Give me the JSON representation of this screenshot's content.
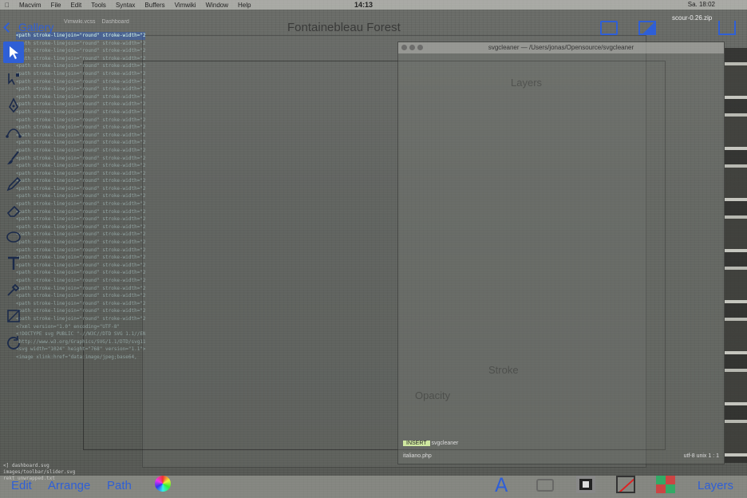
{
  "menubar": {
    "items": [
      "Macvim",
      "File",
      "Edit",
      "Tools",
      "Syntax",
      "Buffers",
      "Vimwiki",
      "Window",
      "Help"
    ],
    "clock": "14:13",
    "right_text": "Sa. 18:02"
  },
  "topbar": {
    "back_label": "Gallery",
    "document_title": "Fontainebleau Forest",
    "zip_label": "scour-0.26.zip"
  },
  "editor": {
    "tabs": [
      "Vimwiki.vcss",
      "Dashboard"
    ],
    "lines": [
      "<path stroke-linejoin=\"round\" stroke-width=\"2\" d=",
      "<path stroke-linejoin=\"round\" stroke-width=\"2\" d=",
      "<path stroke-linejoin=\"round\" stroke-width=\"2\" d=",
      "<path stroke-linejoin=\"round\" stroke-width=\"2\" d=",
      "<path stroke-linejoin=\"round\" stroke-width=\"2\" d=",
      "<path stroke-linejoin=\"round\" stroke-width=\"2\" d=",
      "<path stroke-linejoin=\"round\" stroke-width=\"2\" d=",
      "<path stroke-linejoin=\"round\" stroke-width=\"2\" d=",
      "<path stroke-linejoin=\"round\" stroke-width=\"2\" d=",
      "<path stroke-linejoin=\"round\" stroke-width=\"2\" d=",
      "<path stroke-linejoin=\"round\" stroke-width=\"2\" d=",
      "<path stroke-linejoin=\"round\" stroke-width=\"2\" d=",
      "<path stroke-linejoin=\"round\" stroke-width=\"2\" d=",
      "<path stroke-linejoin=\"round\" stroke-width=\"2\" d=",
      "<path stroke-linejoin=\"round\" stroke-width=\"2\" d=",
      "<path stroke-linejoin=\"round\" stroke-width=\"2\" d=",
      "<path stroke-linejoin=\"round\" stroke-width=\"2\" d=",
      "<path stroke-linejoin=\"round\" stroke-width=\"2\" d=",
      "<path stroke-linejoin=\"round\" stroke-width=\"2\" d=",
      "<path stroke-linejoin=\"round\" stroke-width=\"2\" d=",
      "<path stroke-linejoin=\"round\" stroke-width=\"2\" d=",
      "<path stroke-linejoin=\"round\" stroke-width=\"2\" d=",
      "<path stroke-linejoin=\"round\" stroke-width=\"2\" d=",
      "<path stroke-linejoin=\"round\" stroke-width=\"2\" d=",
      "<path stroke-linejoin=\"round\" stroke-width=\"2\" d=",
      "<path stroke-linejoin=\"round\" stroke-width=\"2\" d=",
      "<path stroke-linejoin=\"round\" stroke-width=\"2\" d=",
      "<path stroke-linejoin=\"round\" stroke-width=\"2\" d=",
      "<path stroke-linejoin=\"round\" stroke-width=\"2\" d=",
      "<path stroke-linejoin=\"round\" stroke-width=\"2\" d=",
      "<path stroke-linejoin=\"round\" stroke-width=\"2\" d=",
      "<path stroke-linejoin=\"round\" stroke-width=\"2\" d=",
      "<path stroke-linejoin=\"round\" stroke-width=\"2\" d=",
      "<path stroke-linejoin=\"round\" stroke-width=\"2\" d=",
      "<path stroke-linejoin=\"round\" stroke-width=\"2\" d=",
      "<path stroke-linejoin=\"round\" stroke-width=\"2\" d=",
      "<path stroke-linejoin=\"round\" stroke-width=\"2\" d=",
      "<path stroke-linejoin=\"round\" stroke-width=\"2\" d=",
      "<?xml version=\"1.0\" encoding=\"UTF-8\"",
      "<!DOCTYPE svg PUBLIC \"-//W3C//DTD SVG 1.1//EN\"",
      "\"http://www.w3.org/Graphics/SVG/1.1/DTD/svg11.dtd\">",
      "<svg width=\"1024\" height=\"768\" version=\"1.1\">",
      "<image xlink:href=\"data:image/jpeg;base64,"
    ],
    "status_lines": [
      "<] dashboard.svg",
      "images/toolbar/slider.svg",
      "rekt  unwrapped.txt"
    ]
  },
  "finder": {
    "title": "svgcleaner — /Users/jonas/Opensource/svgcleaner",
    "status_tag": "INSERT",
    "status_file": "svgcleaner",
    "footer": "utf-8  unix  1 : 1",
    "extra_file": "italiano.php"
  },
  "ghost_text": {
    "layers_title": "Layers",
    "stroke_label": "Stroke",
    "opacity_label": "Opacity"
  },
  "bottombar": {
    "edit_label": "Edit",
    "arrange_label": "Arrange",
    "path_label": "Path",
    "layers_label": "Layers"
  },
  "colors": {
    "accent": "#2f5fd6",
    "active_tool": "#2f5fd6",
    "stroke_red": "#dd2222"
  },
  "tools": [
    "select-tool",
    "node-tool",
    "pen-tool",
    "bezier-tool",
    "brush-tool",
    "pencil-tool",
    "eraser-tool",
    "shape-tool",
    "text-tool",
    "eyedropper-tool",
    "crop-tool",
    "rotate-tool"
  ]
}
